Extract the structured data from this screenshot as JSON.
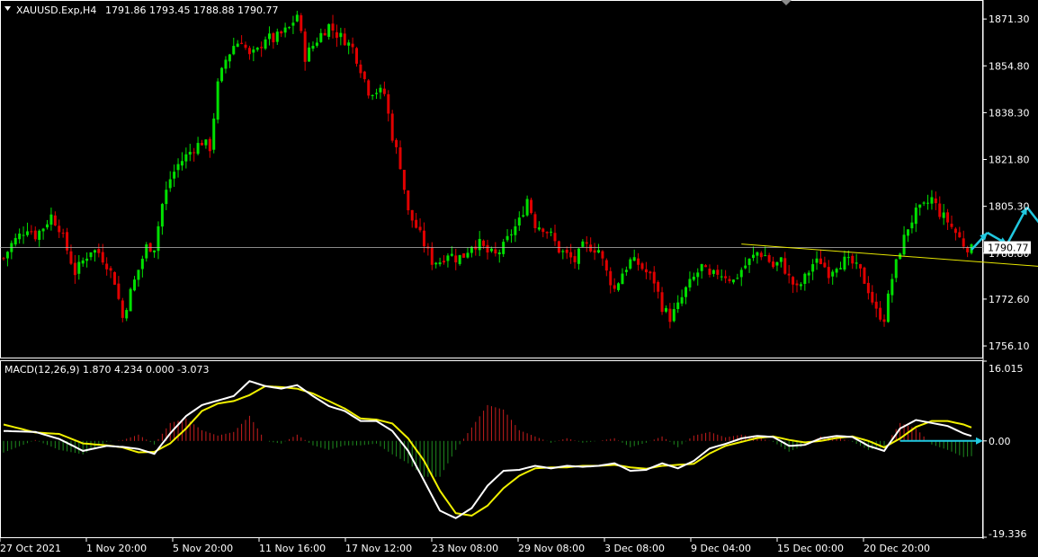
{
  "symbol_header": {
    "symbol": "XAUUSD.Exp,H4",
    "ohlc": "1791.86 1793.45 1788.88 1790.77"
  },
  "macd_header": {
    "label": "MACD(12,26,9) 1.870 4.234 0.000 -3.073"
  },
  "colors": {
    "background": "#000000",
    "frame": "#ffffff",
    "bull_candle": "#00e000",
    "bear_candle": "#e00000",
    "price_line": "#b8b8b8",
    "trend_line": "#e6e600",
    "projection": "#21c8e0",
    "macd_main": "#ffffff",
    "macd_signal": "#f0f000",
    "macd_zero": "#21c8e0"
  },
  "chart_data": [
    {
      "type": "candlestick",
      "name": "XAUUSD.Exp,H4",
      "current_price": 1790.77,
      "current_price_label": "1790.77",
      "y_ticks": [
        "1871.30",
        "1854.80",
        "1838.30",
        "1821.80",
        "1805.30",
        "1788.80",
        "1772.60",
        "1756.10"
      ],
      "x_ticks": [
        "27 Oct 2021",
        "1 Nov 20:00",
        "5 Nov 20:00",
        "11 Nov 16:00",
        "17 Nov 12:00",
        "23 Nov 08:00",
        "29 Nov 08:00",
        "3 Dec 08:00",
        "9 Dec 04:00",
        "15 Dec 00:00",
        "20 Dec 20:00"
      ],
      "ylim": [
        1752.0,
        1878.0
      ],
      "close_path": [
        [
          0,
          1787
        ],
        [
          2,
          1792
        ],
        [
          4,
          1795
        ],
        [
          6,
          1798
        ],
        [
          8,
          1795
        ],
        [
          10,
          1798
        ],
        [
          12,
          1802
        ],
        [
          14,
          1798
        ],
        [
          16,
          1790
        ],
        [
          18,
          1782
        ],
        [
          20,
          1786
        ],
        [
          22,
          1790
        ],
        [
          24,
          1789
        ],
        [
          26,
          1785
        ],
        [
          28,
          1779
        ],
        [
          30,
          1766
        ],
        [
          32,
          1775
        ],
        [
          34,
          1783
        ],
        [
          36,
          1791
        ],
        [
          38,
          1791
        ],
        [
          40,
          1806
        ],
        [
          42,
          1815
        ],
        [
          44,
          1820
        ],
        [
          46,
          1823
        ],
        [
          48,
          1826
        ],
        [
          50,
          1828
        ],
        [
          52,
          1826
        ],
        [
          54,
          1848
        ],
        [
          56,
          1857
        ],
        [
          58,
          1862
        ],
        [
          60,
          1864
        ],
        [
          62,
          1858
        ],
        [
          64,
          1860
        ],
        [
          66,
          1865
        ],
        [
          68,
          1864
        ],
        [
          70,
          1866
        ],
        [
          72,
          1868
        ],
        [
          74,
          1873
        ],
        [
          76,
          1858
        ],
        [
          78,
          1862
        ],
        [
          80,
          1866
        ],
        [
          82,
          1869
        ],
        [
          84,
          1866
        ],
        [
          86,
          1864
        ],
        [
          88,
          1861
        ],
        [
          90,
          1854
        ],
        [
          92,
          1846
        ],
        [
          94,
          1846
        ],
        [
          96,
          1845
        ],
        [
          98,
          1830
        ],
        [
          100,
          1820
        ],
        [
          102,
          1803
        ],
        [
          104,
          1798
        ],
        [
          106,
          1792
        ],
        [
          108,
          1786
        ],
        [
          110,
          1786
        ],
        [
          112,
          1789
        ],
        [
          114,
          1787
        ],
        [
          116,
          1788
        ],
        [
          118,
          1792
        ],
        [
          120,
          1792
        ],
        [
          122,
          1789
        ],
        [
          124,
          1788
        ],
        [
          126,
          1791
        ],
        [
          128,
          1796
        ],
        [
          130,
          1800
        ],
        [
          132,
          1808
        ],
        [
          134,
          1799
        ],
        [
          136,
          1798
        ],
        [
          138,
          1795
        ],
        [
          140,
          1790
        ],
        [
          142,
          1788
        ],
        [
          144,
          1786
        ],
        [
          146,
          1791
        ],
        [
          148,
          1791
        ],
        [
          150,
          1790
        ],
        [
          152,
          1782
        ],
        [
          154,
          1776
        ],
        [
          156,
          1782
        ],
        [
          158,
          1786
        ],
        [
          160,
          1785
        ],
        [
          162,
          1782
        ],
        [
          164,
          1779
        ],
        [
          166,
          1770
        ],
        [
          168,
          1766
        ],
        [
          170,
          1770
        ],
        [
          172,
          1776
        ],
        [
          174,
          1780
        ],
        [
          176,
          1784
        ],
        [
          178,
          1780
        ],
        [
          180,
          1782
        ],
        [
          182,
          1781
        ],
        [
          184,
          1779
        ],
        [
          186,
          1783
        ],
        [
          188,
          1786
        ],
        [
          190,
          1789
        ],
        [
          192,
          1788
        ],
        [
          194,
          1784
        ],
        [
          196,
          1786
        ],
        [
          198,
          1780
        ],
        [
          200,
          1776
        ],
        [
          202,
          1780
        ],
        [
          204,
          1785
        ],
        [
          206,
          1786
        ],
        [
          208,
          1782
        ],
        [
          210,
          1785
        ],
        [
          212,
          1786
        ],
        [
          214,
          1785
        ],
        [
          216,
          1782
        ],
        [
          218,
          1776
        ],
        [
          220,
          1768
        ],
        [
          222,
          1766
        ],
        [
          224,
          1780
        ],
        [
          226,
          1790
        ],
        [
          228,
          1798
        ],
        [
          230,
          1803
        ],
        [
          232,
          1805
        ],
        [
          234,
          1808
        ],
        [
          236,
          1803
        ],
        [
          238,
          1800
        ],
        [
          240,
          1796
        ],
        [
          242,
          1792
        ],
        [
          244,
          1790
        ]
      ],
      "trend_line": {
        "from": [
          186,
          1792
        ],
        "to": [
          272,
          1783
        ]
      },
      "projection_path": [
        [
          244,
          1790
        ],
        [
          248,
          1796
        ],
        [
          253,
          1792
        ],
        [
          258,
          1805
        ],
        [
          263,
          1796
        ],
        [
          271,
          1820
        ]
      ]
    },
    {
      "type": "line",
      "name": "MACD(12,26,9)",
      "ylim": [
        -19.336,
        16.015
      ],
      "y_ticks": [
        "16.015",
        "0.00",
        "-19.336"
      ],
      "series": [
        {
          "key": "main",
          "path": [
            [
              0,
              2.0
            ],
            [
              8,
              1.8
            ],
            [
              14,
              0.4
            ],
            [
              20,
              -2.0
            ],
            [
              26,
              -1.0
            ],
            [
              30,
              -1.2
            ],
            [
              34,
              -1.6
            ],
            [
              38,
              -2.6
            ],
            [
              42,
              1.5
            ],
            [
              46,
              5.0
            ],
            [
              50,
              7.2
            ],
            [
              54,
              8.1
            ],
            [
              58,
              9.0
            ],
            [
              62,
              12.0
            ],
            [
              66,
              11.0
            ],
            [
              70,
              10.5
            ],
            [
              74,
              11.2
            ],
            [
              78,
              9.0
            ],
            [
              82,
              7.0
            ],
            [
              86,
              6.0
            ],
            [
              90,
              4.0
            ],
            [
              94,
              4.0
            ],
            [
              98,
              2.0
            ],
            [
              102,
              -2.0
            ],
            [
              106,
              -8.0
            ],
            [
              110,
              -14.0
            ],
            [
              114,
              -15.5
            ],
            [
              118,
              -13.5
            ],
            [
              122,
              -9.0
            ],
            [
              126,
              -6.0
            ],
            [
              130,
              -5.8
            ],
            [
              134,
              -5.0
            ],
            [
              138,
              -5.5
            ],
            [
              142,
              -5.0
            ],
            [
              146,
              -5.2
            ],
            [
              150,
              -5.0
            ],
            [
              154,
              -4.5
            ],
            [
              158,
              -6.0
            ],
            [
              162,
              -5.8
            ],
            [
              166,
              -4.5
            ],
            [
              170,
              -5.5
            ],
            [
              174,
              -4.0
            ],
            [
              178,
              -1.5
            ],
            [
              182,
              -0.6
            ],
            [
              186,
              0.5
            ],
            [
              190,
              1.0
            ],
            [
              194,
              0.8
            ],
            [
              198,
              -1.0
            ],
            [
              202,
              -0.8
            ],
            [
              206,
              0.5
            ],
            [
              210,
              1.0
            ],
            [
              214,
              0.8
            ],
            [
              218,
              -1.0
            ],
            [
              222,
              -2.0
            ],
            [
              226,
              2.5
            ],
            [
              230,
              4.2
            ],
            [
              234,
              3.6
            ],
            [
              238,
              3.0
            ],
            [
              242,
              1.5
            ],
            [
              244,
              1.0
            ]
          ]
        },
        {
          "key": "signal",
          "path": [
            [
              0,
              3.3
            ],
            [
              8,
              1.7
            ],
            [
              14,
              1.4
            ],
            [
              20,
              -0.5
            ],
            [
              26,
              -0.9
            ],
            [
              30,
              -1.3
            ],
            [
              34,
              -2.3
            ],
            [
              38,
              -2.2
            ],
            [
              42,
              -0.5
            ],
            [
              46,
              2.5
            ],
            [
              50,
              6.0
            ],
            [
              54,
              7.5
            ],
            [
              58,
              8.0
            ],
            [
              62,
              9.2
            ],
            [
              66,
              11.0
            ],
            [
              70,
              10.8
            ],
            [
              74,
              10.5
            ],
            [
              78,
              9.5
            ],
            [
              82,
              8.0
            ],
            [
              86,
              6.5
            ],
            [
              90,
              4.5
            ],
            [
              94,
              4.3
            ],
            [
              98,
              3.5
            ],
            [
              102,
              0.5
            ],
            [
              106,
              -4.0
            ],
            [
              110,
              -10.0
            ],
            [
              114,
              -14.5
            ],
            [
              118,
              -15.0
            ],
            [
              122,
              -13.0
            ],
            [
              126,
              -9.5
            ],
            [
              130,
              -7.0
            ],
            [
              134,
              -5.5
            ],
            [
              138,
              -5.3
            ],
            [
              142,
              -5.3
            ],
            [
              146,
              -5.0
            ],
            [
              150,
              -5.0
            ],
            [
              154,
              -4.8
            ],
            [
              158,
              -5.3
            ],
            [
              162,
              -5.6
            ],
            [
              166,
              -5.0
            ],
            [
              170,
              -4.8
            ],
            [
              174,
              -4.6
            ],
            [
              178,
              -2.5
            ],
            [
              182,
              -1.0
            ],
            [
              186,
              -0.2
            ],
            [
              190,
              0.6
            ],
            [
              194,
              0.9
            ],
            [
              198,
              0.2
            ],
            [
              202,
              -0.3
            ],
            [
              206,
              0.0
            ],
            [
              210,
              0.6
            ],
            [
              214,
              0.9
            ],
            [
              218,
              0.0
            ],
            [
              222,
              -1.3
            ],
            [
              226,
              0.5
            ],
            [
              230,
              2.8
            ],
            [
              234,
              4.0
            ],
            [
              238,
              4.0
            ],
            [
              242,
              3.3
            ],
            [
              244,
              2.7
            ]
          ]
        }
      ],
      "zero_projection": [
        [
          226,
          0
        ],
        [
          272,
          0
        ]
      ]
    }
  ]
}
